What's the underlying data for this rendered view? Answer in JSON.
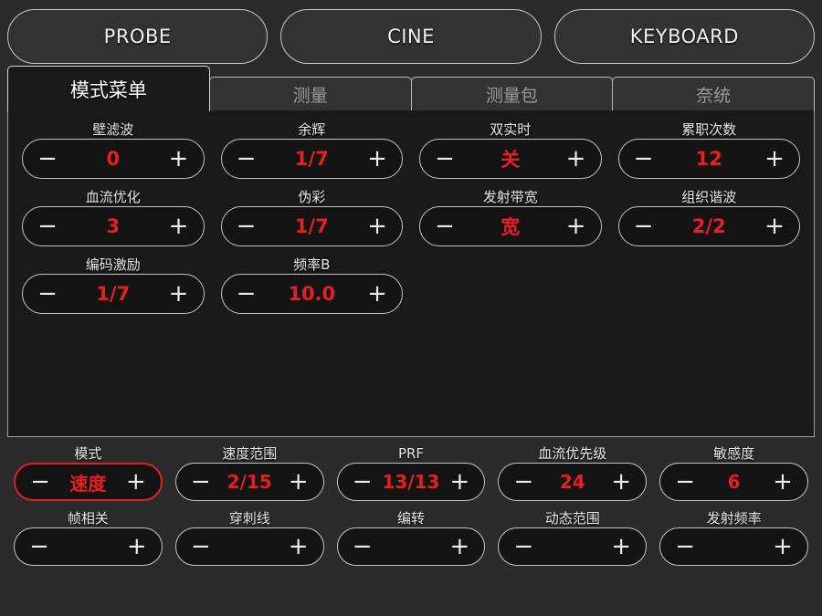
{
  "topbar": {
    "buttons": [
      {
        "label": "PROBE",
        "name": "probe-button"
      },
      {
        "label": "CINE",
        "name": "cine-button"
      },
      {
        "label": "KEYBOARD",
        "name": "keyboard-button"
      }
    ]
  },
  "tabs": [
    {
      "label": "模式菜单",
      "active": true
    },
    {
      "label": "测量",
      "active": false
    },
    {
      "label": "测量包",
      "active": false
    },
    {
      "label": "奈统",
      "active": false
    }
  ],
  "panel": {
    "controls": [
      {
        "label": "壁滤波",
        "value": "0",
        "minus": "−",
        "plus": "+"
      },
      {
        "label": "余辉",
        "value": "1/7",
        "minus": "−",
        "plus": "+"
      },
      {
        "label": "双实时",
        "value": "关",
        "minus": "−",
        "plus": "+"
      },
      {
        "label": "累职次数",
        "value": "12",
        "minus": "−",
        "plus": "+"
      },
      {
        "label": "血流优化",
        "value": "3",
        "minus": "−",
        "plus": "+"
      },
      {
        "label": "伪彩",
        "value": "1/7",
        "minus": "−",
        "plus": "+"
      },
      {
        "label": "发射带宽",
        "value": "宽",
        "minus": "−",
        "plus": "+"
      },
      {
        "label": "组织谐波",
        "value": "2/2",
        "minus": "−",
        "plus": "+"
      },
      {
        "label": "编码激励",
        "value": "1/7",
        "minus": "−",
        "plus": "+"
      },
      {
        "label": "频率B",
        "value": "10.0",
        "minus": "−",
        "plus": "+"
      }
    ]
  },
  "bottom": {
    "row1": [
      {
        "label": "模式",
        "value": "速度",
        "selected": true,
        "minus": "−",
        "plus": "+"
      },
      {
        "label": "速度范围",
        "value": "2/15",
        "selected": false,
        "minus": "−",
        "plus": "+"
      },
      {
        "label": "PRF",
        "value": "13/13",
        "selected": false,
        "minus": "−",
        "plus": "+"
      },
      {
        "label": "血流优先级",
        "value": "24",
        "selected": false,
        "minus": "−",
        "plus": "+"
      },
      {
        "label": "敏感度",
        "value": "6",
        "selected": false,
        "minus": "−",
        "plus": "+"
      }
    ],
    "row2": [
      {
        "label": "帧相关",
        "value": "",
        "selected": false,
        "minus": "−",
        "plus": "+"
      },
      {
        "label": "穿刺线",
        "value": "",
        "selected": false,
        "minus": "−",
        "plus": "+"
      },
      {
        "label": "编转",
        "value": "",
        "selected": false,
        "minus": "−",
        "plus": "+"
      },
      {
        "label": "动态范围",
        "value": "",
        "selected": false,
        "minus": "−",
        "plus": "+"
      },
      {
        "label": "发射频率",
        "value": "",
        "selected": false,
        "minus": "−",
        "plus": "+"
      }
    ]
  },
  "colors": {
    "background": "#2b2b2b",
    "panel": "#1a1a1a",
    "control_fill": "#141414",
    "border": "#c4c4c4",
    "value_red": "#e81f1f",
    "selected_border": "#e02020",
    "label": "#e8e8e8",
    "tab_inactive_text": "#9a9a9a"
  }
}
